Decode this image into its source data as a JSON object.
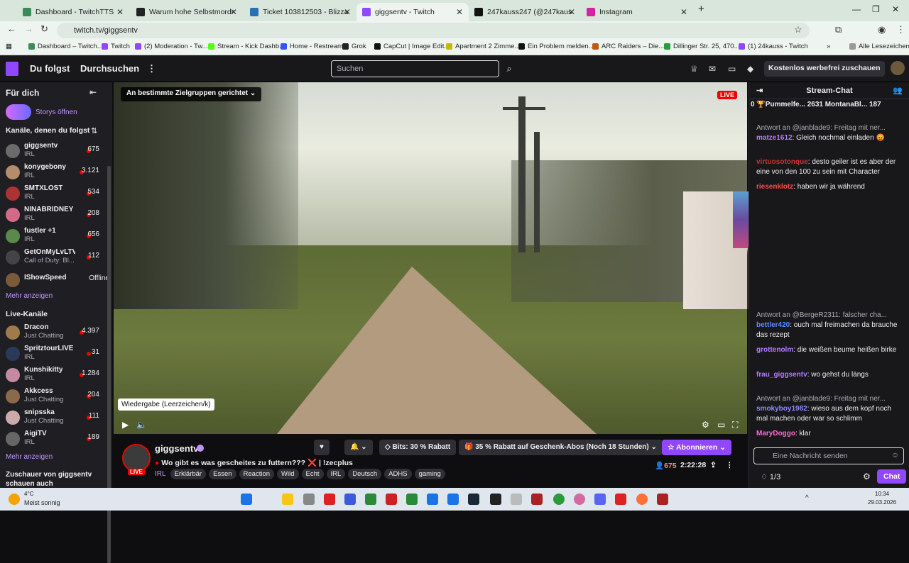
{
  "browser": {
    "tabs": [
      {
        "title": "Dashboard - TwitchTTS",
        "color": "#3b8a5a"
      },
      {
        "title": "Warum hohe Selbstmordrat",
        "color": "#222222"
      },
      {
        "title": "Ticket 103812503 - Blizzard-Ku",
        "color": "#2a6fb5"
      },
      {
        "title": "giggsentv - Twitch",
        "color": "#9147ff"
      },
      {
        "title": "247kauss247 (@247kauss247) |",
        "color": "#111111"
      },
      {
        "title": "Instagram",
        "color": "#d6249f"
      }
    ],
    "new_tab_icon": "+",
    "url": "twitch.tv/giggsentv",
    "bookmarks": [
      "Dashboard – Twitch...",
      "Twitch",
      "(2) Moderation - Tw...",
      "Stream - Kick Dashb...",
      "Home - Restream",
      "Grok",
      "CapCut | Image Edit...",
      "Apartment 2 Zimme...",
      "Ein Problem melden...",
      "ARC Raiders – Die...",
      "Dillinger Str. 25, 470...",
      "(1) 24kauss - Twitch"
    ],
    "all_bookmarks": "Alle Lesezeichen"
  },
  "header": {
    "following": "Du folgst",
    "browse": "Durchsuchen",
    "search_placeholder": "Suchen",
    "promo": "Kostenlos werbefrei zuschauen"
  },
  "sidebar": {
    "for_you": "Für dich",
    "stories": "Storys öffnen",
    "followed_heading": "Kanäle, denen du folgst",
    "followed": [
      {
        "name": "giggsentv",
        "category": "IRL",
        "viewers": "675",
        "color": "#6b6b6b"
      },
      {
        "name": "konygebony",
        "category": "IRL",
        "viewers": "3.121",
        "color": "#b58d6a"
      },
      {
        "name": "SMTXLOST",
        "category": "IRL",
        "viewers": "534",
        "color": "#a33"
      },
      {
        "name": "NINABRIDNEY",
        "category": "IRL",
        "viewers": "208",
        "color": "#d36a8a"
      },
      {
        "name": "fustler +1",
        "category": "IRL",
        "viewers": "656",
        "color": "#5a8a4a"
      },
      {
        "name": "GetOnMyLvLTV",
        "category": "Call of Duty: Bl...",
        "viewers": "112",
        "color": "#444"
      },
      {
        "name": "IShowSpeed",
        "category": "",
        "viewers": "Offline",
        "color": "#7a5a3a"
      }
    ],
    "show_more": "Mehr anzeigen",
    "live_heading": "Live-Kanäle",
    "live": [
      {
        "name": "Dracon",
        "category": "Just Chatting",
        "viewers": "4.397",
        "color": "#a07a4a"
      },
      {
        "name": "SpritztourLIVE",
        "category": "IRL",
        "viewers": "31",
        "color": "#2a3a5a"
      },
      {
        "name": "Kunshikitty",
        "category": "IRL",
        "viewers": "1.284",
        "color": "#c58aa0"
      },
      {
        "name": "Akkcess",
        "category": "Just Chatting",
        "viewers": "204",
        "color": "#8a6a4a"
      },
      {
        "name": "snipsska",
        "category": "Just Chatting",
        "viewers": "111",
        "color": "#caa"
      },
      {
        "name": "AigiTV",
        "category": "IRL",
        "viewers": "189",
        "color": "#666"
      }
    ],
    "show_more_2": "Mehr anzeigen",
    "viewers_of": "Zuschauer von giggsentv",
    "viewers_of_2": "schauen auch"
  },
  "player": {
    "audience": "An bestimmte Zielgruppen gerichtet",
    "live": "LIVE",
    "tooltip": "Wiedergabe (Leerzeichen/k)"
  },
  "stream": {
    "name": "giggsentv",
    "live_badge": "LIVE",
    "title": "Wo gibt es was gescheites zu futtern??? ❌ | !zecplus",
    "category": "IRL",
    "tags": [
      "Erklärbär",
      "Essen",
      "Reaction",
      "Wild",
      "Echt",
      "IRL",
      "Deutsch",
      "ADHS",
      "gaming"
    ],
    "bits": "Bits: 30 % Rabatt",
    "gift": "35 % Rabatt auf Geschenk-Abos (Noch 18 Stunden)",
    "subscribe": "Abonnieren",
    "viewers": "675",
    "uptime": "2:22:28"
  },
  "chat": {
    "title": "Stream-Chat",
    "gifts": "0 🏆Pummelfe...  2631  MontanaBl...  187",
    "messages": [
      {
        "reply": "Antwort an @janblade9: Freitag mit ner...",
        "user": "matze1612",
        "color": "#b57aff",
        "text": ": Gleich nochmal einladen 😡"
      },
      {
        "reply": "",
        "user": "virtuosotonque",
        "color": "#cc3333",
        "text": ": desto geiler ist es aber der eine von den 100 zu sein mit Character"
      },
      {
        "reply": "",
        "user": "riesenklotz",
        "color": "#ff4a4a",
        "text": ": haben wir ja während"
      },
      {
        "reply": "Antwort an @BergeR2311: falscher cha...",
        "user": "bettler420",
        "color": "#5a8aff",
        "text": ": ouch mal freimachen da brauche das rezept"
      },
      {
        "reply": "",
        "user": "grottenolm",
        "color": "#b57aff",
        "text": ": die weißen beume heißen birke"
      },
      {
        "reply": "",
        "user": "frau_giggsentv",
        "color": "#b57aff",
        "text": ": wo gehst du längs"
      },
      {
        "reply": "Antwort an @janblade9: Freitag mit ner...",
        "user": "smokyboy1982",
        "color": "#8a8aff",
        "text": ": wieso aus dem kopf noch mal machen oder war so schlimm"
      },
      {
        "reply": "",
        "user": "MaryDoggo",
        "color": "#ff6bd0",
        "text": ": klar"
      }
    ],
    "input_placeholder": "Eine Nachricht senden",
    "points": "1/3",
    "chat_button": "Chat"
  },
  "taskbar": {
    "weather_temp": "4°C",
    "weather_text": "Meist sonnig",
    "time": "10:34",
    "date": "29.03.2026"
  }
}
